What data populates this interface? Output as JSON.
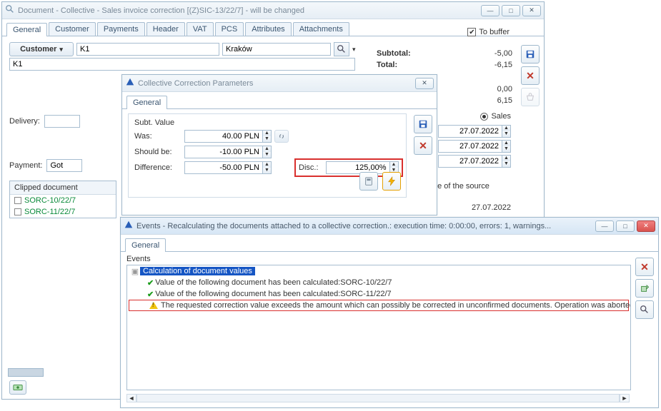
{
  "main": {
    "title": "Document - Collective - Sales invoice correction [(Z)SIC-13/22/7]  - will be changed",
    "tabs": [
      "General",
      "Customer",
      "Payments",
      "Header",
      "VAT",
      "PCS",
      "Attributes",
      "Attachments"
    ],
    "toBufferLabel": "To buffer",
    "toBufferChecked": true,
    "customerBtn": "Customer",
    "customerName": "K1",
    "customerCity": "Kraków",
    "customerLine2": "K1",
    "deliveryLabel": "Delivery:",
    "paymentLabel": "Payment:",
    "paymentValue": "Got",
    "clippedHeader": "Clipped document",
    "clippedItems": [
      "SORC-10/22/7",
      "SORC-11/22/7"
    ],
    "totals": {
      "subtotalLabel": "Subtotal:",
      "subtotalValue": "-5,00",
      "totalLabel": "Total:",
      "totalValue": "-6,15",
      "extra1": "0,00",
      "extra2": "6,15"
    },
    "salesLabel": "Sales",
    "dates": [
      "27.07.2022",
      "27.07.2022",
      "27.07.2022"
    ],
    "sourceDateLabel": "Date of the source",
    "sourceDateValue": "27.07.2022"
  },
  "params": {
    "title": "Collective Correction Parameters",
    "tab": "General",
    "subtValueLabel": "Subt. Value",
    "rows": {
      "wasLabel": "Was:",
      "wasValue": "40.00 PLN",
      "shouldLabel": "Should be:",
      "shouldValue": "-10.00 PLN",
      "diffLabel": "Difference:",
      "diffValue": "-50.00 PLN"
    },
    "discLabel": "Disc.:",
    "discValue": "125,00%"
  },
  "events": {
    "title": "Events - Recalculating the documents attached to a collective correction.: execution time:  0:00:00, errors: 1, warnings...",
    "tab": "General",
    "header": "Events",
    "tree": {
      "root": "Calculation of document values",
      "ok1": "Value of the following document has been calculated:SORC-10/22/7",
      "ok2": "Value of the following document has been calculated:SORC-11/22/7",
      "warn": "The requested correction value exceeds the amount which can possibly be corrected in unconfirmed documents. Operation was aborted."
    }
  }
}
